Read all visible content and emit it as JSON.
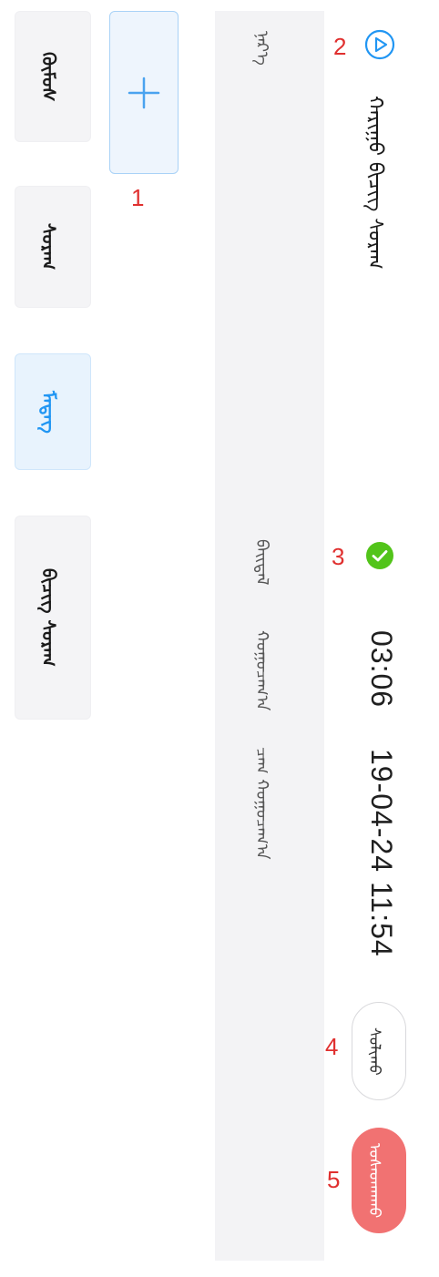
{
  "left_categories": [
    {
      "label": "ᠬᠦᠮᠦᠰ",
      "active": false
    },
    {
      "label": "ᠰᠤᠷᠠᠭ",
      "active": false
    },
    {
      "label": "ᠮᠡᠳᠡᠭ",
      "active": true
    },
    {
      "label": "ᠪᠢᠴᠢᠭ ᠰᠤᠷᠠᠭ",
      "active": false
    }
  ],
  "add_tile": {
    "icon": "plus-icon"
  },
  "markers": [
    "1",
    "2",
    "3",
    "4",
    "5"
  ],
  "panel": {
    "top_label": "ᠨᠡᠷ᠎ᠡ",
    "status_label": "ᠪᠠᠢᠳᠠᠯ",
    "duration_label": "ᠬᠤᠭᠤᠴᠠᠭ᠎ᠠ",
    "time_label": "ᠴᠠᠭ ᠬᠤᠭᠤᠴᠠᠭ᠎ᠠ"
  },
  "item": {
    "title": "ᠬᠠᠷᠢᠭᠤ ᠪᠢᠴᠢᠭ ᠰᠤᠷᠠᠭ",
    "play_icon": "play-circle-icon",
    "status_icon": "check-circle-icon",
    "duration": "03:06",
    "datetime": "19-04-24 11:54"
  },
  "buttons": {
    "secondary": "ᠰᠤᠯᠢᠬᠤ",
    "delete": "ᠤᠰᠠᠳᠬᠠᠬᠤ"
  },
  "colors": {
    "accent": "#2196f3",
    "success": "#52c41a",
    "danger": "#f17272",
    "marker": "#e0302f"
  }
}
